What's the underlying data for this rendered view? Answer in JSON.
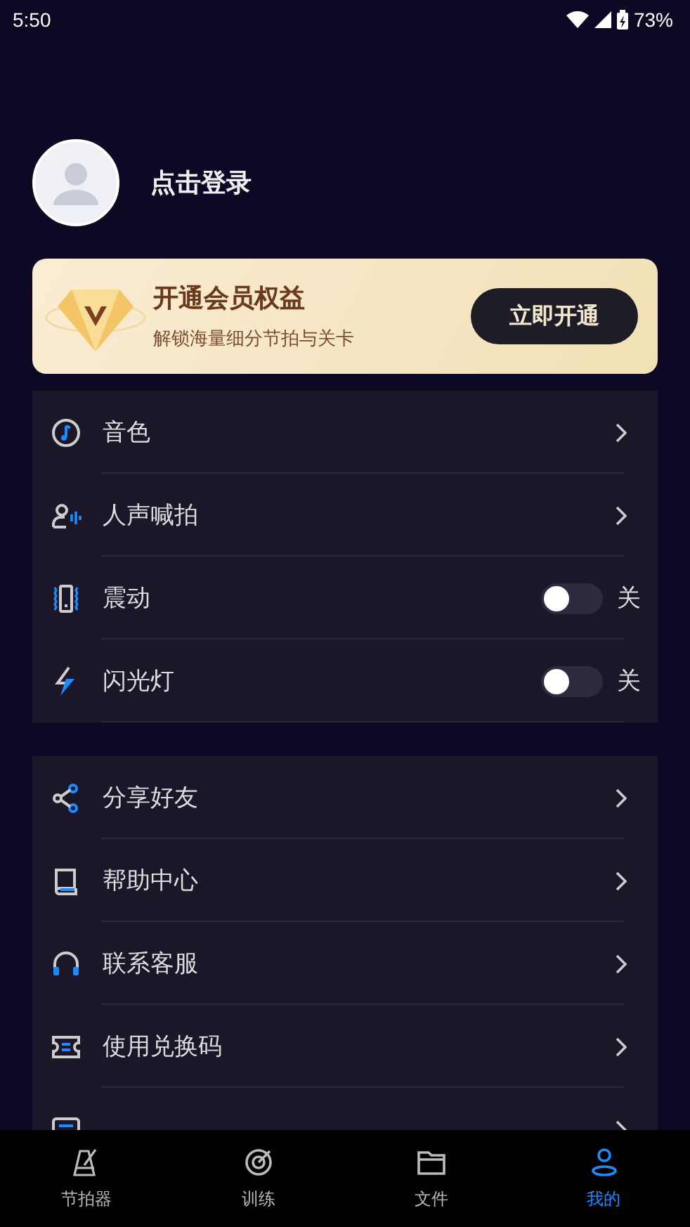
{
  "status_bar": {
    "time": "5:50",
    "battery": "73%"
  },
  "profile": {
    "login_label": "点击登录"
  },
  "vip_card": {
    "title": "开通会员权益",
    "subtitle": "解锁海量细分节拍与关卡",
    "button": "立即开通"
  },
  "settings_groups": [
    {
      "items": [
        {
          "kind": "link",
          "label": "音色"
        },
        {
          "kind": "link",
          "label": "人声喊拍"
        },
        {
          "kind": "toggle",
          "label": "震动",
          "on": false,
          "state_label": "关"
        },
        {
          "kind": "toggle",
          "label": "闪光灯",
          "on": false,
          "state_label": "关"
        }
      ]
    },
    {
      "items": [
        {
          "kind": "link",
          "label": "分享好友"
        },
        {
          "kind": "link",
          "label": "帮助中心"
        },
        {
          "kind": "link",
          "label": "联系客服"
        },
        {
          "kind": "link",
          "label": "使用兑换码"
        },
        {
          "kind": "link"
        }
      ]
    }
  ],
  "tab_bar": [
    {
      "label": "节拍器",
      "selected": false
    },
    {
      "label": "训练",
      "selected": false
    },
    {
      "label": "文件",
      "selected": false
    },
    {
      "label": "我的",
      "selected": true
    }
  ]
}
